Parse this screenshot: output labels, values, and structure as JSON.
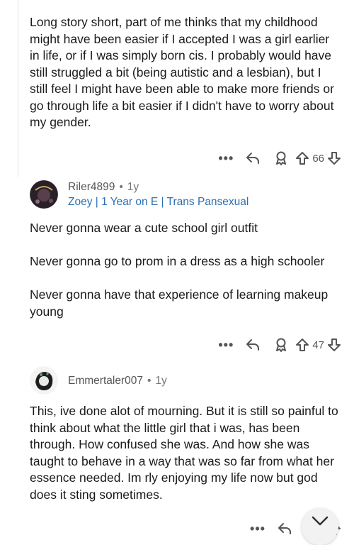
{
  "comments": [
    {
      "body": "Long story short, part of me thinks that my childhood might have been easier if I accepted I was a girl earlier in life, or if I was simply born cis. I probably would have still struggled a bit (being autistic and a lesbian), but I still feel I might have been able to make more friends or go through life a bit easier if I didn't have to worry about my gender.",
      "votes": "66"
    },
    {
      "username": "Riler4899",
      "age": "1y",
      "flair": "Zoey | 1 Year on E | Trans Pansexual",
      "body": "Never gonna wear a cute school girl outfit\n\nNever gonna go to prom in a dress as a high schooler\n\nNever gonna have that experience of learning makeup young",
      "votes": "47"
    },
    {
      "username": "Emmertaler007",
      "age": "1y",
      "body": "This, ive done alot of mourning. But it is still so painful to think about what the little girl that i was, has been through. How confused she was. And how she was taught to behave in a way that was so far from what her essence needed. Im rly enjoying my life now but god does it sting sometimes."
    }
  ],
  "separator": "•",
  "more_label": "•••",
  "icons": [
    "more-icon",
    "reply-icon",
    "award-icon",
    "upvote-icon",
    "downvote-icon",
    "scroll-down-icon"
  ]
}
